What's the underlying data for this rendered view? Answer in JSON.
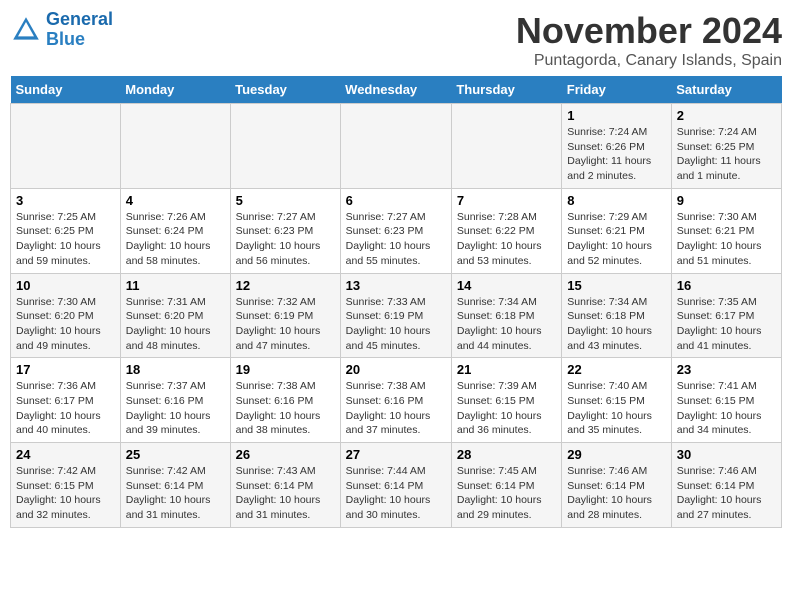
{
  "header": {
    "logo_line1": "General",
    "logo_line2": "Blue",
    "month": "November 2024",
    "location": "Puntagorda, Canary Islands, Spain"
  },
  "weekdays": [
    "Sunday",
    "Monday",
    "Tuesday",
    "Wednesday",
    "Thursday",
    "Friday",
    "Saturday"
  ],
  "weeks": [
    [
      {
        "day": "",
        "info": ""
      },
      {
        "day": "",
        "info": ""
      },
      {
        "day": "",
        "info": ""
      },
      {
        "day": "",
        "info": ""
      },
      {
        "day": "",
        "info": ""
      },
      {
        "day": "1",
        "info": "Sunrise: 7:24 AM\nSunset: 6:26 PM\nDaylight: 11 hours\nand 2 minutes."
      },
      {
        "day": "2",
        "info": "Sunrise: 7:24 AM\nSunset: 6:25 PM\nDaylight: 11 hours\nand 1 minute."
      }
    ],
    [
      {
        "day": "3",
        "info": "Sunrise: 7:25 AM\nSunset: 6:25 PM\nDaylight: 10 hours\nand 59 minutes."
      },
      {
        "day": "4",
        "info": "Sunrise: 7:26 AM\nSunset: 6:24 PM\nDaylight: 10 hours\nand 58 minutes."
      },
      {
        "day": "5",
        "info": "Sunrise: 7:27 AM\nSunset: 6:23 PM\nDaylight: 10 hours\nand 56 minutes."
      },
      {
        "day": "6",
        "info": "Sunrise: 7:27 AM\nSunset: 6:23 PM\nDaylight: 10 hours\nand 55 minutes."
      },
      {
        "day": "7",
        "info": "Sunrise: 7:28 AM\nSunset: 6:22 PM\nDaylight: 10 hours\nand 53 minutes."
      },
      {
        "day": "8",
        "info": "Sunrise: 7:29 AM\nSunset: 6:21 PM\nDaylight: 10 hours\nand 52 minutes."
      },
      {
        "day": "9",
        "info": "Sunrise: 7:30 AM\nSunset: 6:21 PM\nDaylight: 10 hours\nand 51 minutes."
      }
    ],
    [
      {
        "day": "10",
        "info": "Sunrise: 7:30 AM\nSunset: 6:20 PM\nDaylight: 10 hours\nand 49 minutes."
      },
      {
        "day": "11",
        "info": "Sunrise: 7:31 AM\nSunset: 6:20 PM\nDaylight: 10 hours\nand 48 minutes."
      },
      {
        "day": "12",
        "info": "Sunrise: 7:32 AM\nSunset: 6:19 PM\nDaylight: 10 hours\nand 47 minutes."
      },
      {
        "day": "13",
        "info": "Sunrise: 7:33 AM\nSunset: 6:19 PM\nDaylight: 10 hours\nand 45 minutes."
      },
      {
        "day": "14",
        "info": "Sunrise: 7:34 AM\nSunset: 6:18 PM\nDaylight: 10 hours\nand 44 minutes."
      },
      {
        "day": "15",
        "info": "Sunrise: 7:34 AM\nSunset: 6:18 PM\nDaylight: 10 hours\nand 43 minutes."
      },
      {
        "day": "16",
        "info": "Sunrise: 7:35 AM\nSunset: 6:17 PM\nDaylight: 10 hours\nand 41 minutes."
      }
    ],
    [
      {
        "day": "17",
        "info": "Sunrise: 7:36 AM\nSunset: 6:17 PM\nDaylight: 10 hours\nand 40 minutes."
      },
      {
        "day": "18",
        "info": "Sunrise: 7:37 AM\nSunset: 6:16 PM\nDaylight: 10 hours\nand 39 minutes."
      },
      {
        "day": "19",
        "info": "Sunrise: 7:38 AM\nSunset: 6:16 PM\nDaylight: 10 hours\nand 38 minutes."
      },
      {
        "day": "20",
        "info": "Sunrise: 7:38 AM\nSunset: 6:16 PM\nDaylight: 10 hours\nand 37 minutes."
      },
      {
        "day": "21",
        "info": "Sunrise: 7:39 AM\nSunset: 6:15 PM\nDaylight: 10 hours\nand 36 minutes."
      },
      {
        "day": "22",
        "info": "Sunrise: 7:40 AM\nSunset: 6:15 PM\nDaylight: 10 hours\nand 35 minutes."
      },
      {
        "day": "23",
        "info": "Sunrise: 7:41 AM\nSunset: 6:15 PM\nDaylight: 10 hours\nand 34 minutes."
      }
    ],
    [
      {
        "day": "24",
        "info": "Sunrise: 7:42 AM\nSunset: 6:15 PM\nDaylight: 10 hours\nand 32 minutes."
      },
      {
        "day": "25",
        "info": "Sunrise: 7:42 AM\nSunset: 6:14 PM\nDaylight: 10 hours\nand 31 minutes."
      },
      {
        "day": "26",
        "info": "Sunrise: 7:43 AM\nSunset: 6:14 PM\nDaylight: 10 hours\nand 31 minutes."
      },
      {
        "day": "27",
        "info": "Sunrise: 7:44 AM\nSunset: 6:14 PM\nDaylight: 10 hours\nand 30 minutes."
      },
      {
        "day": "28",
        "info": "Sunrise: 7:45 AM\nSunset: 6:14 PM\nDaylight: 10 hours\nand 29 minutes."
      },
      {
        "day": "29",
        "info": "Sunrise: 7:46 AM\nSunset: 6:14 PM\nDaylight: 10 hours\nand 28 minutes."
      },
      {
        "day": "30",
        "info": "Sunrise: 7:46 AM\nSunset: 6:14 PM\nDaylight: 10 hours\nand 27 minutes."
      }
    ]
  ]
}
